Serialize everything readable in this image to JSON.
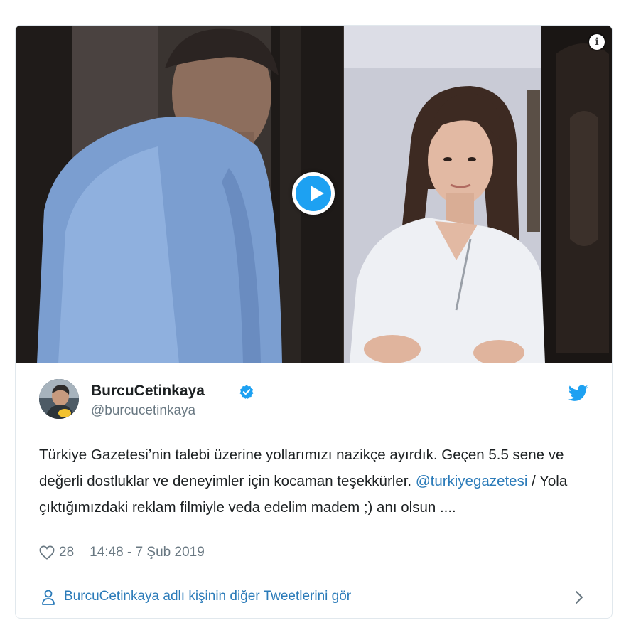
{
  "media": {
    "info_icon": "info-icon",
    "play_icon": "play-icon",
    "info_glyph": "i"
  },
  "tweet": {
    "author_name": "BurcuCetinkaya",
    "author_handle": "@burcucetinkaya",
    "verified_icon": "verified-badge-icon",
    "brand_icon": "twitter-bird-icon",
    "text_part1": "Türkiye Gazetesi’nin talebi üzerine yollarımızı nazikçe ayırdık. Geçen 5.5 sene ve değerli dostluklar ve deneyimler için kocaman teşekkürler. ",
    "mention": "@turkiyegazetesi",
    "text_part2": " / Yola çıktığımızdaki reklam filmiyle veda edelim madem ;) anı olsun ....",
    "likes": "28",
    "timestamp": "14:48 - 7 Şub 2019"
  },
  "footer": {
    "label": "BurcuCetinkaya adlı kişinin diğer Tweetlerini gör",
    "person_icon": "person-icon",
    "chevron_icon": "chevron-right-icon"
  },
  "colors": {
    "link": "#2b7bb9",
    "brand": "#1da1f2",
    "muted": "#697882",
    "border": "#e1e8ed"
  }
}
